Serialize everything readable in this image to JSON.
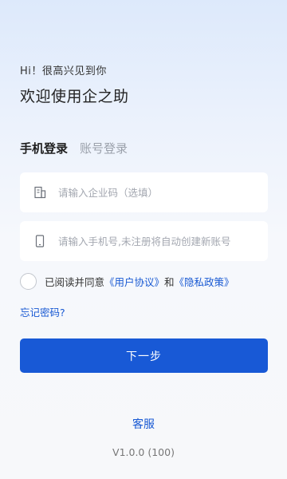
{
  "header": {
    "greeting": "Hi！很高兴见到你",
    "welcome": "欢迎使用企之助"
  },
  "tabs": [
    {
      "label": "手机登录",
      "active": true
    },
    {
      "label": "账号登录",
      "active": false
    }
  ],
  "form": {
    "company_code": {
      "value": "",
      "placeholder": "请输入企业码（选填）",
      "icon": "building-icon"
    },
    "phone": {
      "value": "",
      "placeholder": "请输入手机号,未注册将自动创建新账号",
      "icon": "phone-icon"
    }
  },
  "agreement": {
    "checked": false,
    "prefix": "已阅读并同意",
    "user_agreement": "《用户协议》",
    "and": "和",
    "privacy_policy": "《隐私政策》"
  },
  "forgot_password": "忘记密码?",
  "next_button": "下一步",
  "customer_service": "客服",
  "version": "V1.0.0 (100)",
  "colors": {
    "primary": "#1859d6",
    "link": "#1859d3",
    "background_top": "#dde9fb"
  }
}
